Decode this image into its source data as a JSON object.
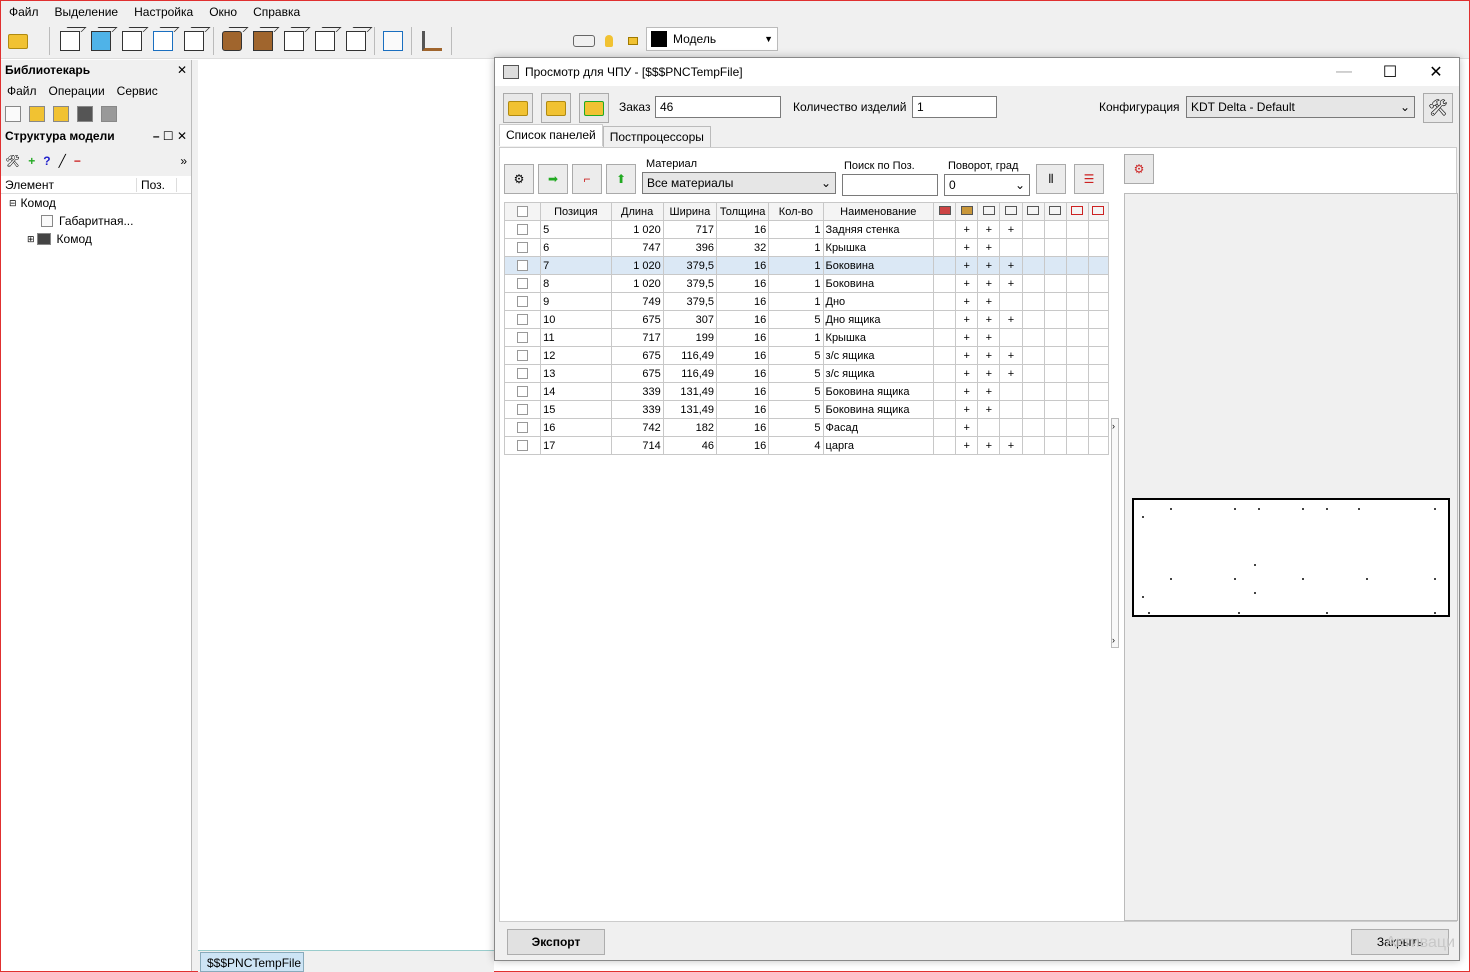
{
  "menu": [
    "Файл",
    "Выделение",
    "Настройка",
    "Окно",
    "Справка"
  ],
  "model_selector": "Модель",
  "library": {
    "title": "Библиотекарь",
    "menu": [
      "Файл",
      "Операции",
      "Сервис"
    ]
  },
  "structure": {
    "title": "Структура модели",
    "col_element": "Элемент",
    "col_pos": "Поз.",
    "root": "Комод",
    "child1": "Габаритная...",
    "child2": "Комод"
  },
  "bottom_tab": "$$$PNCTempFile",
  "dialog": {
    "title": "Просмотр для ЧПУ - [$$$PNCTempFile]",
    "order_label": "Заказ",
    "order_value": "46",
    "qty_label": "Количество изделий",
    "qty_value": "1",
    "config_label": "Конфигурация",
    "config_value": "KDT Delta - Default",
    "tabs": [
      "Список панелей",
      "Постпроцессоры"
    ],
    "material_label": "Материал",
    "material_value": "Все материалы",
    "search_label": "Поиск по Поз.",
    "search_value": "",
    "rotate_label": "Поворот, град",
    "rotate_value": "0",
    "columns": [
      "Позиция",
      "Длина",
      "Ширина",
      "Толщина",
      "Кол-во",
      "Наименование"
    ],
    "rows": [
      {
        "pos": "5",
        "len": "1 020",
        "wid": "717",
        "thk": "16",
        "qty": "1",
        "name": "Задняя стенка",
        "p1": "+",
        "p2": "+",
        "p3": "+"
      },
      {
        "pos": "6",
        "len": "747",
        "wid": "396",
        "thk": "32",
        "qty": "1",
        "name": "Крышка",
        "p1": "+",
        "p2": "+",
        "p3": ""
      },
      {
        "pos": "7",
        "len": "1 020",
        "wid": "379,5",
        "thk": "16",
        "qty": "1",
        "name": "Боковина",
        "p1": "+",
        "p2": "+",
        "p3": "+"
      },
      {
        "pos": "8",
        "len": "1 020",
        "wid": "379,5",
        "thk": "16",
        "qty": "1",
        "name": "Боковина",
        "p1": "+",
        "p2": "+",
        "p3": "+"
      },
      {
        "pos": "9",
        "len": "749",
        "wid": "379,5",
        "thk": "16",
        "qty": "1",
        "name": "Дно",
        "p1": "+",
        "p2": "+",
        "p3": ""
      },
      {
        "pos": "10",
        "len": "675",
        "wid": "307",
        "thk": "16",
        "qty": "5",
        "name": "Дно ящика",
        "p1": "+",
        "p2": "+",
        "p3": "+"
      },
      {
        "pos": "11",
        "len": "717",
        "wid": "199",
        "thk": "16",
        "qty": "1",
        "name": "Крышка",
        "p1": "+",
        "p2": "+",
        "p3": ""
      },
      {
        "pos": "12",
        "len": "675",
        "wid": "116,49",
        "thk": "16",
        "qty": "5",
        "name": "з/с ящика",
        "p1": "+",
        "p2": "+",
        "p3": "+"
      },
      {
        "pos": "13",
        "len": "675",
        "wid": "116,49",
        "thk": "16",
        "qty": "5",
        "name": "з/с ящика",
        "p1": "+",
        "p2": "+",
        "p3": "+"
      },
      {
        "pos": "14",
        "len": "339",
        "wid": "131,49",
        "thk": "16",
        "qty": "5",
        "name": "Боковина ящика",
        "p1": "+",
        "p2": "+",
        "p3": ""
      },
      {
        "pos": "15",
        "len": "339",
        "wid": "131,49",
        "thk": "16",
        "qty": "5",
        "name": "Боковина ящика",
        "p1": "+",
        "p2": "+",
        "p3": ""
      },
      {
        "pos": "16",
        "len": "742",
        "wid": "182",
        "thk": "16",
        "qty": "5",
        "name": "Фасад",
        "p1": "+",
        "p2": "",
        "p3": ""
      },
      {
        "pos": "17",
        "len": "714",
        "wid": "46",
        "thk": "16",
        "qty": "4",
        "name": "царга",
        "p1": "+",
        "p2": "+",
        "p3": "+"
      }
    ],
    "selected_row": 2,
    "export_label": "Экспорт",
    "close_label": "Закрыть"
  },
  "watermark": "Активаци"
}
